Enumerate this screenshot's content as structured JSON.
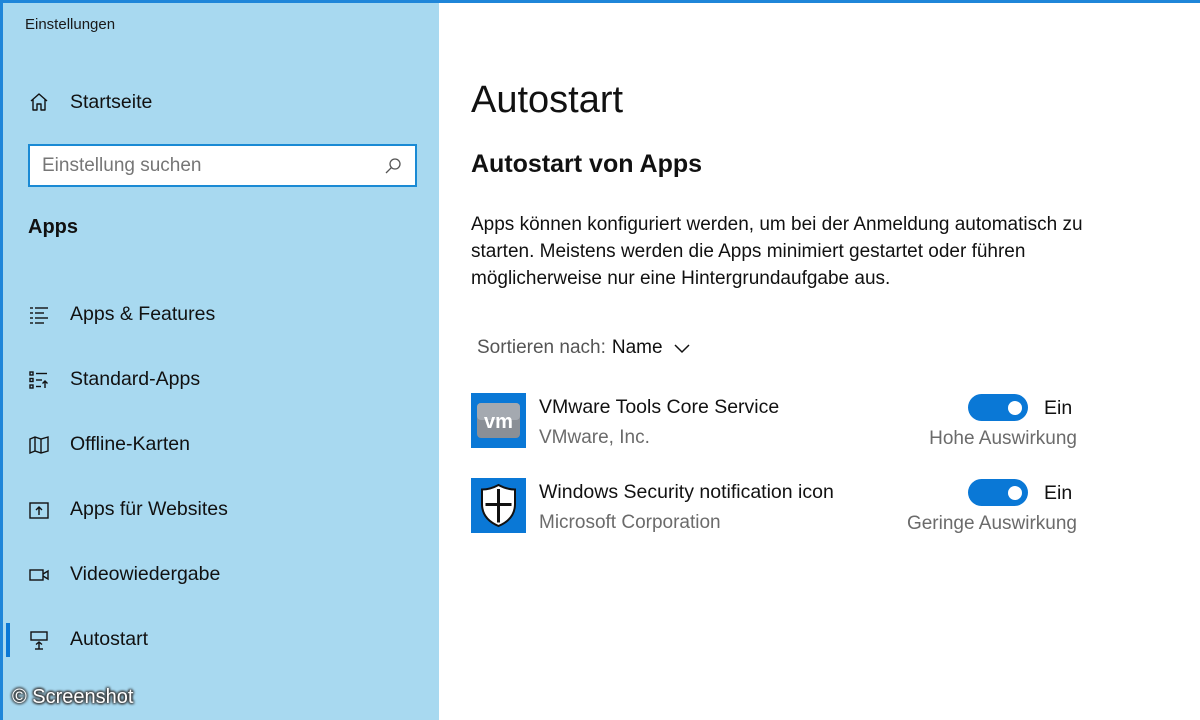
{
  "window": {
    "title": "Einstellungen"
  },
  "sidebar": {
    "home_label": "Startseite",
    "search": {
      "placeholder": "Einstellung suchen",
      "value": ""
    },
    "section_heading": "Apps",
    "items": [
      {
        "label": "Apps & Features",
        "icon": "list-icon"
      },
      {
        "label": "Standard-Apps",
        "icon": "default-apps-icon"
      },
      {
        "label": "Offline-Karten",
        "icon": "map-icon"
      },
      {
        "label": "Apps für Websites",
        "icon": "website-app-icon"
      },
      {
        "label": "Videowiedergabe",
        "icon": "video-icon"
      },
      {
        "label": "Autostart",
        "icon": "startup-icon",
        "active": true
      }
    ]
  },
  "watermark": "© Screenshot",
  "main": {
    "title": "Autostart",
    "subtitle": "Autostart von Apps",
    "description": "Apps können konfiguriert werden, um bei der Anmeldung automatisch zu starten. Meistens werden die Apps minimiert gestartet oder führen möglicherweise nur eine Hintergrundaufgabe aus.",
    "sort": {
      "label": "Sortieren nach:",
      "value": "Name"
    },
    "apps": [
      {
        "name": "VMware Tools Core Service",
        "publisher": "VMware, Inc.",
        "enabled": true,
        "state_label": "Ein",
        "impact": "Hohe Auswirkung",
        "icon": "vmware-icon",
        "icon_text": "vm"
      },
      {
        "name": "Windows Security notification icon",
        "publisher": "Microsoft Corporation",
        "enabled": true,
        "state_label": "Ein",
        "impact": "Geringe Auswirkung",
        "icon": "windows-security-shield-icon"
      }
    ]
  },
  "colors": {
    "sidebar_bg": "#a8d9f0",
    "accent": "#0a78d6",
    "icon_bg": "#0a78d6"
  }
}
